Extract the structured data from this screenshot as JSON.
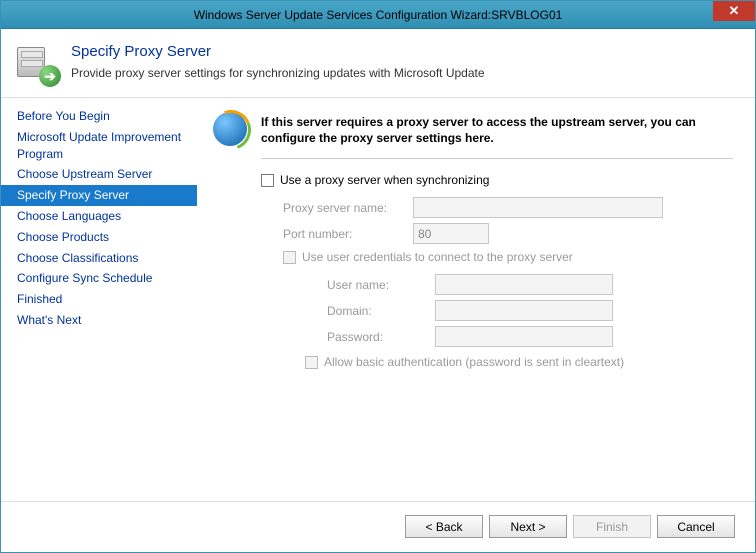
{
  "window": {
    "title": "Windows Server Update Services Configuration Wizard:SRVBLOG01"
  },
  "header": {
    "title": "Specify Proxy Server",
    "subtitle": "Provide proxy server settings for synchronizing updates with Microsoft Update"
  },
  "sidebar": {
    "items": [
      "Before You Begin",
      "Microsoft Update Improvement Program",
      "Choose Upstream Server",
      "Specify Proxy Server",
      "Choose Languages",
      "Choose Products",
      "Choose Classifications",
      "Configure Sync Schedule",
      "Finished",
      "What's Next"
    ],
    "selected_index": 3
  },
  "content": {
    "intro": "If this server requires a proxy server to access the upstream server, you can configure the proxy server settings here.",
    "use_proxy_label": "Use a proxy server when synchronizing",
    "use_proxy_checked": false,
    "proxy_name_label": "Proxy server name:",
    "proxy_name_value": "",
    "port_label": "Port number:",
    "port_value": "80",
    "use_creds_label": "Use user credentials to connect to the proxy server",
    "use_creds_checked": false,
    "username_label": "User name:",
    "username_value": "",
    "domain_label": "Domain:",
    "domain_value": "",
    "password_label": "Password:",
    "password_value": "",
    "allow_basic_label": "Allow basic authentication (password is sent in cleartext)",
    "allow_basic_checked": false
  },
  "footer": {
    "back": "< Back",
    "next": "Next >",
    "finish": "Finish",
    "cancel": "Cancel"
  }
}
